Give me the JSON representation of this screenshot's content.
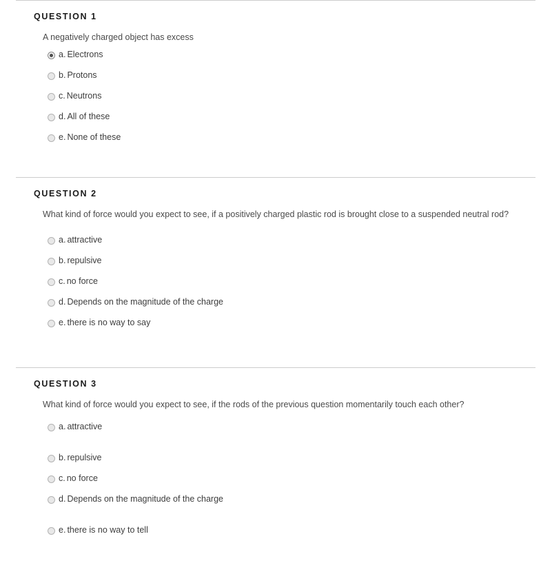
{
  "page": {
    "background_color": "#ffffff",
    "text_color": "#444444",
    "divider_color": "#cccccc"
  },
  "questions": [
    {
      "header": "QUESTION 1",
      "text": "A negatively charged object has excess",
      "options": [
        {
          "letter": "a.",
          "label": "Electrons",
          "selected": true
        },
        {
          "letter": "b.",
          "label": "Protons",
          "selected": false
        },
        {
          "letter": "c.",
          "label": "Neutrons",
          "selected": false
        },
        {
          "letter": "d.",
          "label": "All of these",
          "selected": false
        },
        {
          "letter": "e.",
          "label": "None of these",
          "selected": false
        }
      ]
    },
    {
      "header": "QUESTION 2",
      "text": "What kind of force would you expect to see, if a positively charged plastic rod is brought close to a suspended neutral rod?",
      "options": [
        {
          "letter": "a.",
          "label": "attractive",
          "selected": false
        },
        {
          "letter": "b.",
          "label": "repulsive",
          "selected": false
        },
        {
          "letter": "c.",
          "label": "no force",
          "selected": false
        },
        {
          "letter": "d.",
          "label": "Depends on the magnitude of the charge",
          "selected": false
        },
        {
          "letter": "e.",
          "label": "there is no way to say",
          "selected": false
        }
      ]
    },
    {
      "header": "QUESTION 3",
      "text": "What kind of force would you expect to see, if the rods of the previous question momentarily touch each other?",
      "options": [
        {
          "letter": "a.",
          "label": "attractive",
          "selected": false
        },
        {
          "letter": "b.",
          "label": "repulsive",
          "selected": false
        },
        {
          "letter": "c.",
          "label": "no force",
          "selected": false
        },
        {
          "letter": "d.",
          "label": "Depends on the magnitude of the charge",
          "selected": false
        },
        {
          "letter": "e.",
          "label": "there is no way to tell",
          "selected": false
        }
      ]
    }
  ]
}
